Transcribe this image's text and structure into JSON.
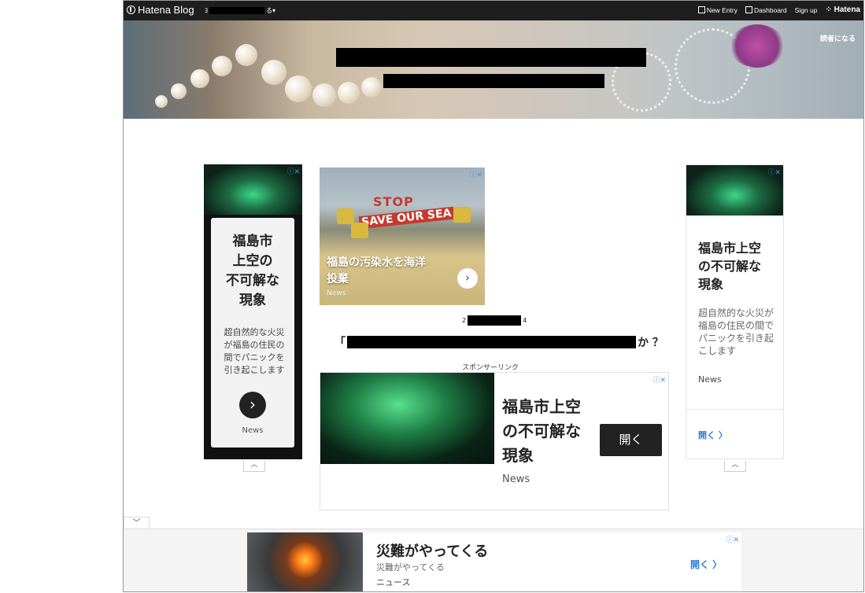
{
  "topbar": {
    "brand": "Hatena Blog",
    "user_prefix": "ﾖ",
    "user_suffix": "る▾",
    "new_entry": "New Entry",
    "dashboard": "Dashboard",
    "signup": "Sign up",
    "hatena": "Hatena"
  },
  "header": {
    "subscribe": "読者になる"
  },
  "left_ad": {
    "title": "福島市\n上空の\n不可解な\n現象",
    "desc": "超自然的な火災が福島の住民の間でパニックを引き起こします",
    "source": "News",
    "adchoice": "ⓘ✕",
    "arrow": "›",
    "collapse": "︿"
  },
  "center_ad": {
    "stop": "STOP",
    "save": "SAVE OUR SEA",
    "headline": "福島の汚染水を海洋\n投棄",
    "source": "News",
    "adchoice": "ⓘ✕",
    "arrow": "›"
  },
  "post": {
    "date_prefix": "2",
    "date_suffix": "4",
    "title_prefix": "「",
    "title_suffix": "か ？",
    "sponsor": "スポンサーリンク"
  },
  "main_ad": {
    "title": "福島市上空\nの不可解な\n現象",
    "source": "News",
    "button": "開く",
    "adchoice": "ⓘ✕"
  },
  "right_ad": {
    "title": "福島市上空\nの不可解な\n現象",
    "desc": "超自然的な火災が福島の住民の間でパニックを引き起こします",
    "source": "News",
    "open": "開く 〉",
    "adchoice": "ⓘ✕",
    "collapse": "︿"
  },
  "footer": {
    "toggle": "﹀",
    "ad": {
      "title": "災難がやってくる",
      "sub": "災難がやってくる",
      "source": "ニュース",
      "open": "開く 〉",
      "adchoice": "ⓘ✕"
    }
  }
}
